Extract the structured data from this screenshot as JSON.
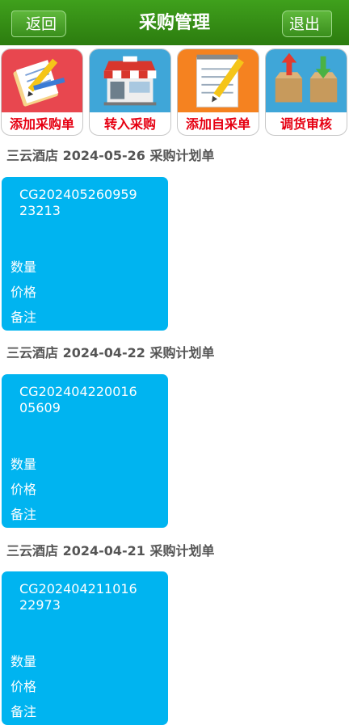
{
  "header": {
    "back_label": "返回",
    "title": "采购管理",
    "exit_label": "退出"
  },
  "actions": [
    {
      "label": "添加采购单",
      "icon": "order-form-icon"
    },
    {
      "label": "转入采购",
      "icon": "shop-icon"
    },
    {
      "label": "添加自采单",
      "icon": "notepad-pencil-icon"
    },
    {
      "label": "调货审核",
      "icon": "boxes-transfer-icon"
    }
  ],
  "plans": [
    {
      "title": "三云酒店 2024-05-26 采购计划单",
      "code": "CG20240526095923213",
      "qty_label": "数量",
      "price_label": "价格",
      "note_label": "备注"
    },
    {
      "title": "三云酒店 2024-04-22 采购计划单",
      "code": "CG20240422001605609",
      "qty_label": "数量",
      "price_label": "价格",
      "note_label": "备注"
    },
    {
      "title": "三云酒店 2024-04-21 采购计划单",
      "code": "CG20240421101622973",
      "qty_label": "数量",
      "price_label": "价格",
      "note_label": "备注"
    }
  ]
}
